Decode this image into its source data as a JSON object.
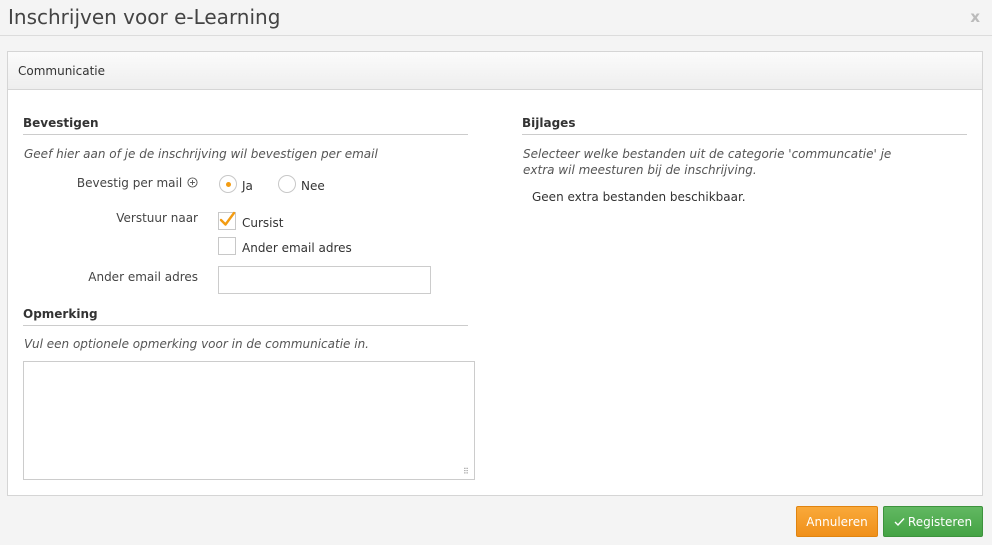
{
  "dialog": {
    "title": "Inschrijven voor e-Learning",
    "close_label": "x"
  },
  "panel": {
    "header": "Communicatie"
  },
  "bevestigen": {
    "title": "Bevestigen",
    "hint": "Geef hier aan of je de inschrijving wil bevestigen per email",
    "confirm_label": "Bevestig per mail",
    "info_icon": "plus-circle-icon",
    "options": [
      {
        "label": "Ja",
        "checked": true
      },
      {
        "label": "Nee",
        "checked": false
      }
    ],
    "send_to_label": "Verstuur naar",
    "recipients": [
      {
        "label": "Cursist",
        "checked": true
      },
      {
        "label": "Ander email adres",
        "checked": false
      }
    ],
    "other_email_label": "Ander email adres",
    "other_email_value": ""
  },
  "opmerking": {
    "title": "Opmerking",
    "hint": "Vul een optionele opmerking voor in de communicatie in.",
    "value": ""
  },
  "bijlages": {
    "title": "Bijlages",
    "hint": "Selecteer welke bestanden uit de categorie 'communcatie' je extra wil meesturen bij de inschrijving.",
    "empty_text": "Geen extra bestanden beschikbaar."
  },
  "footer": {
    "cancel_label": "Annuleren",
    "submit_label": "Registeren",
    "submit_icon": "check-icon"
  },
  "colors": {
    "accent_orange": "#f39c12",
    "success_green": "#4cae4c"
  }
}
